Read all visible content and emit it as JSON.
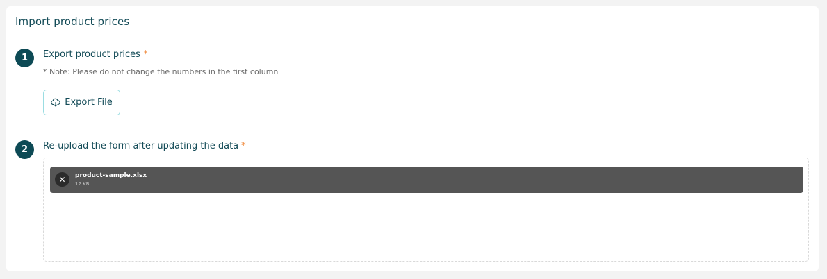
{
  "page": {
    "title": "Import product prices"
  },
  "step1": {
    "number": "1",
    "title": "Export product prices",
    "required_mark": "*",
    "note": "* Note: Please do not change the numbers in the first column",
    "button_label": "Export File",
    "button_icon": "cloud-download-icon"
  },
  "step2": {
    "number": "2",
    "title": "Re-upload the form after updating the data",
    "required_mark": "*",
    "file": {
      "name": "product-sample.xlsx",
      "size": "12 KB",
      "remove_icon": "close-icon",
      "remove_symbol": "✕"
    }
  },
  "colors": {
    "accent": "#0d4a55",
    "title_text": "#134b57",
    "required": "#f08a3c",
    "button_border": "#9bdde2",
    "file_item_bg": "#555555"
  }
}
